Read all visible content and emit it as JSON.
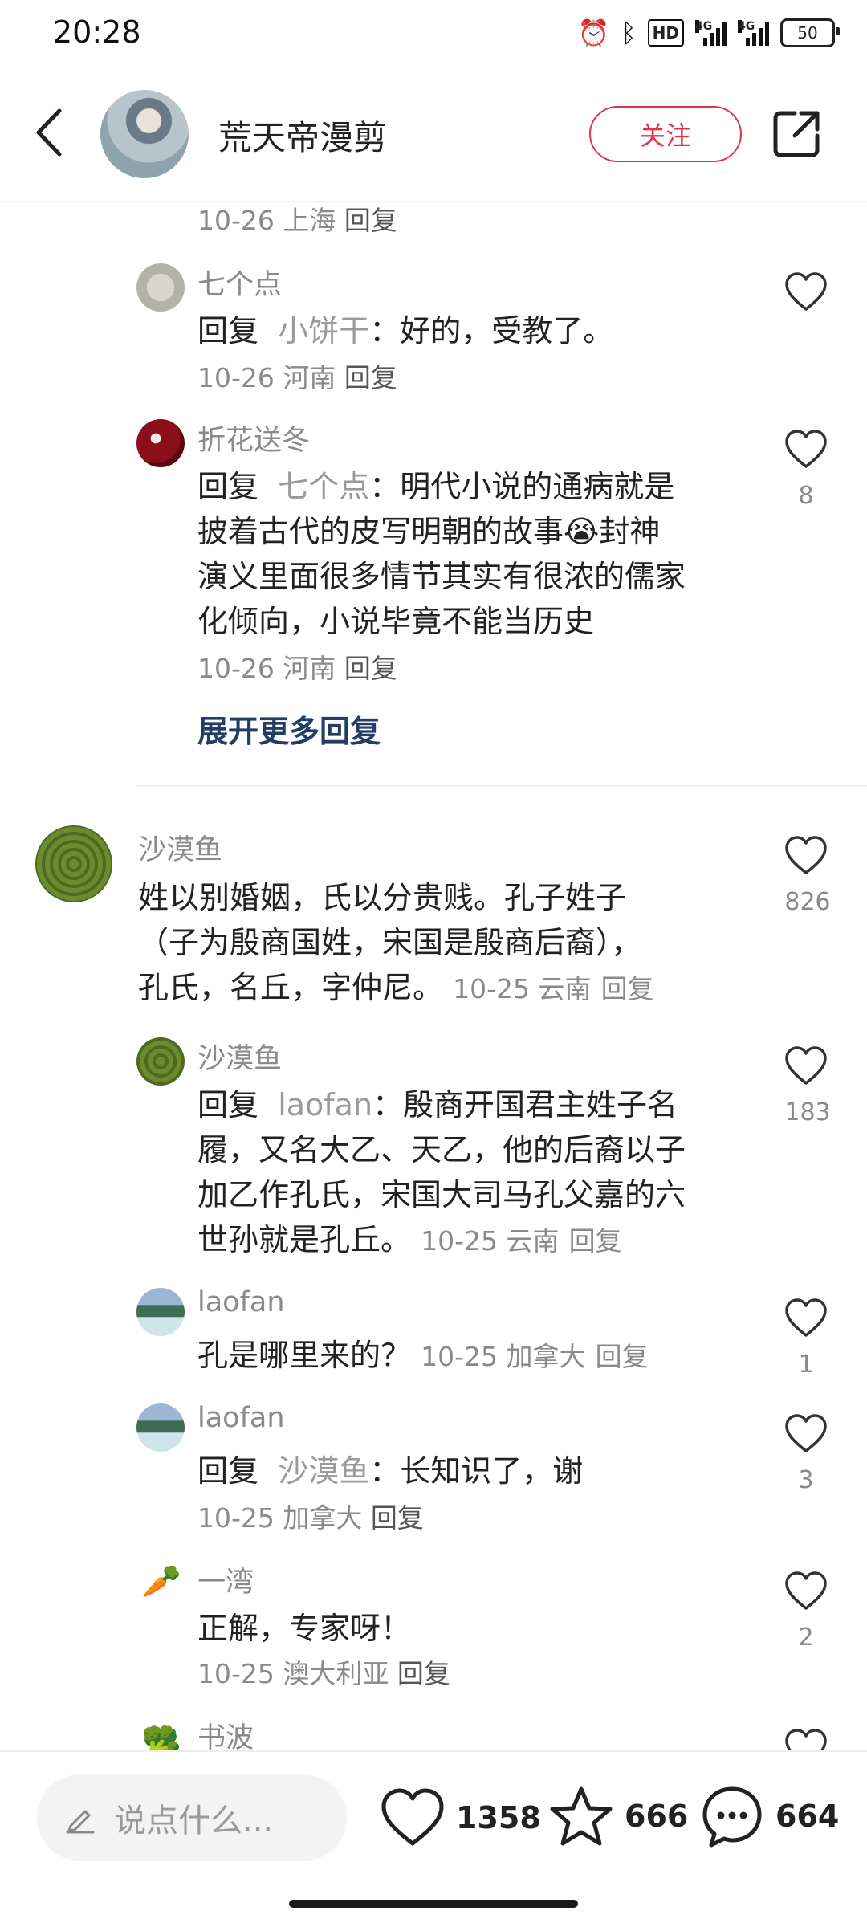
{
  "status_bar": {
    "time": "20:28",
    "hd_label": "HD",
    "net1": "4G",
    "net2": "4G",
    "battery": "50"
  },
  "header": {
    "title": "荒天帝漫剪",
    "follow_label": "关注"
  },
  "comments": {
    "prev_meta": {
      "date_loc": "10-26 上海",
      "reply": "回复"
    },
    "c1": {
      "user": "七个点",
      "reply_word": "回复",
      "target": "小饼干",
      "text": "：好的，受教了。",
      "date_loc": "10-26 河南",
      "reply": "回复"
    },
    "c2": {
      "user": "折花送冬",
      "reply_word": "回复",
      "target": "七个点",
      "text_l1": "：明代小说的通病就是",
      "text_l2": "披着古代的皮写明朝的故事😭封神",
      "text_l3": "演义里面很多情节其实有很浓的儒家",
      "text_l4": "化倾向，小说毕竟不能当历史",
      "date_loc": "10-26 河南",
      "reply": "回复",
      "likes": "8"
    },
    "expand_label": "展开更多回复",
    "c3": {
      "user": "沙漠鱼",
      "text_l1": "姓以别婚姻，氏以分贵贱。孔子姓子",
      "text_l2": "（子为殷商国姓，宋国是殷商后裔），",
      "text_l3": "孔氏，名丘，字仲尼。",
      "date_loc": "10-25 云南",
      "reply": "回复",
      "likes": "826"
    },
    "c4": {
      "user": "沙漠鱼",
      "reply_word": "回复",
      "target": "laofan",
      "text_l1": "：殷商开国君主姓子名",
      "text_l2": "履，又名大乙、天乙，他的后裔以子",
      "text_l3": "加乙作孔氏，宋国大司马孔父嘉的六",
      "text_l4": "世孙就是孔丘。",
      "date_loc": "10-25 云南",
      "reply": "回复",
      "likes": "183"
    },
    "c5": {
      "user": "laofan",
      "text": "孔是哪里来的？",
      "date_loc": "10-25 加拿大",
      "reply": "回复",
      "likes": "1"
    },
    "c6": {
      "user": "laofan",
      "reply_word": "回复",
      "target": "沙漠鱼",
      "text": "：长知识了，谢",
      "date_loc": "10-25 加拿大",
      "reply": "回复",
      "likes": "3"
    },
    "c7": {
      "user": "一湾",
      "text": "正解，专家呀！",
      "date_loc": "10-25 澳大利亚",
      "reply": "回复",
      "likes": "2",
      "avatar_emoji": "🥕"
    },
    "c8": {
      "user": "书波",
      "avatar_emoji": "🥦"
    }
  },
  "bottom_bar": {
    "placeholder": "说点什么...",
    "likes": "1358",
    "favorites": "666",
    "comments": "664"
  },
  "colors": {
    "accent": "#e0344a",
    "link": "#243d66"
  }
}
